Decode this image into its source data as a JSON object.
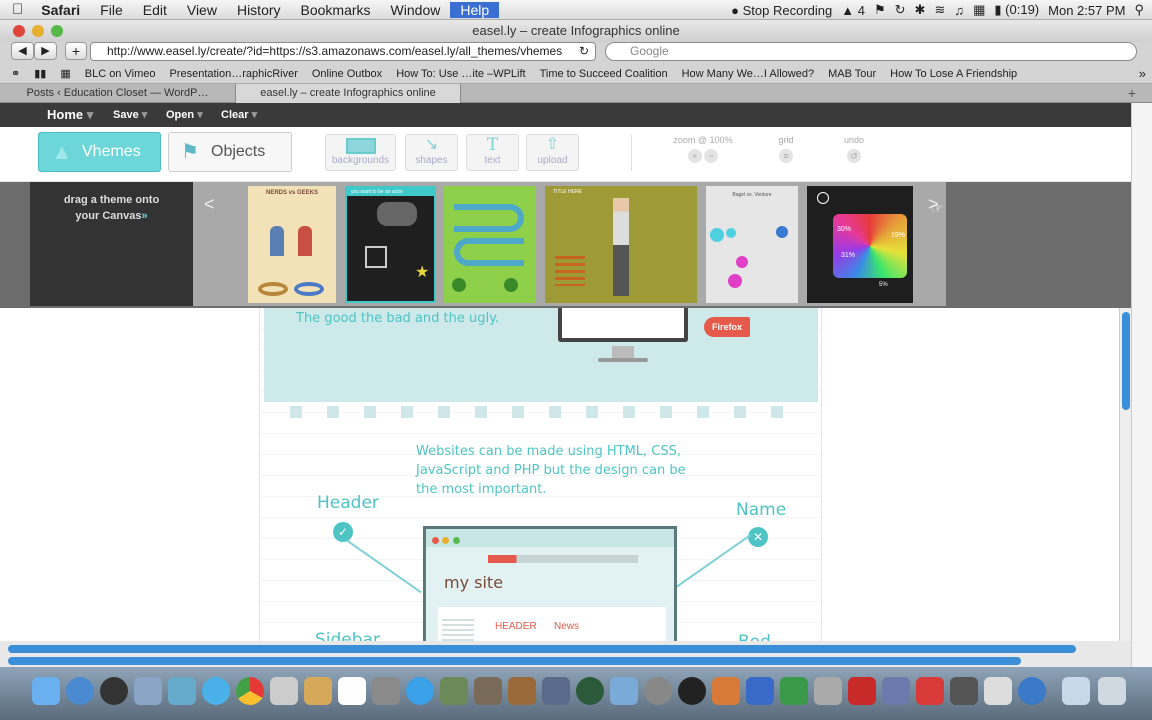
{
  "menubar": {
    "items": [
      "Safari",
      "File",
      "Edit",
      "View",
      "History",
      "Bookmarks",
      "Window",
      "Help"
    ],
    "stop_recording": "Stop Recording",
    "ai_label": "4",
    "battery": "(0:19)",
    "clock": "Mon 2:57 PM"
  },
  "window": {
    "title": "easel.ly – create Infographics online"
  },
  "toolbar": {
    "url": "http://www.easel.ly/create/?id=https://s3.amazonaws.com/easel.ly/all_themes/vhemes",
    "search_placeholder": "Google"
  },
  "bookmarks": [
    "BLC on Vimeo",
    "Presentation…raphicRiver",
    "Online Outbox",
    "How To: Use …ite –WPLift",
    "Time to Succeed Coalition",
    "How Many We…I Allowed?",
    "MAB Tour",
    "How To Lose A Friendship"
  ],
  "tabs": [
    {
      "label": "Posts ‹ Education Closet — WordP…"
    },
    {
      "label": "easel.ly – create Infographics online"
    }
  ],
  "app": {
    "menu": [
      "Home",
      "Save",
      "Open",
      "Clear"
    ],
    "vhemes_label": "Vhemes",
    "objects_label": "Objects",
    "tools": [
      "backgrounds",
      "shapes",
      "text",
      "upload"
    ],
    "text_glyph": "T",
    "zoom_label": "zoom @ 100%",
    "grid_label": "grid",
    "undo_label": "undo",
    "drag_line1": "drag a theme onto",
    "drag_line2": "your Canvas",
    "drag_arrow": "»",
    "nav_prev": "<",
    "nav_next": ">",
    "theme_texts": {
      "t1": "NERDS vs GEEKS",
      "t2": "you want to be an actor",
      "t4": "TITLE HERE",
      "t5": "Bagel vs. Venture",
      "t6a": "30%",
      "t6b": "31%",
      "t6c": "19%",
      "t6d": "5%"
    }
  },
  "canvas": {
    "tagline": "The good the bad and the ugly.",
    "firefox": "Firefox",
    "websites_line1": "Websites can be made using HTML, CSS,",
    "websites_line2": "JavaScript and PHP but the design can be",
    "websites_line3": "the most important.",
    "header_label": "Header",
    "name_label": "Name",
    "site_title": "my site",
    "nav_header": "HEADER",
    "nav_news": "News",
    "sidebar_label": "Sidebar",
    "body_label": "Bod"
  },
  "colors": {
    "accent": "#4ec4c4",
    "teal_light": "#cde9ea",
    "red": "#e55a4a",
    "dark": "#3a3a3a"
  }
}
